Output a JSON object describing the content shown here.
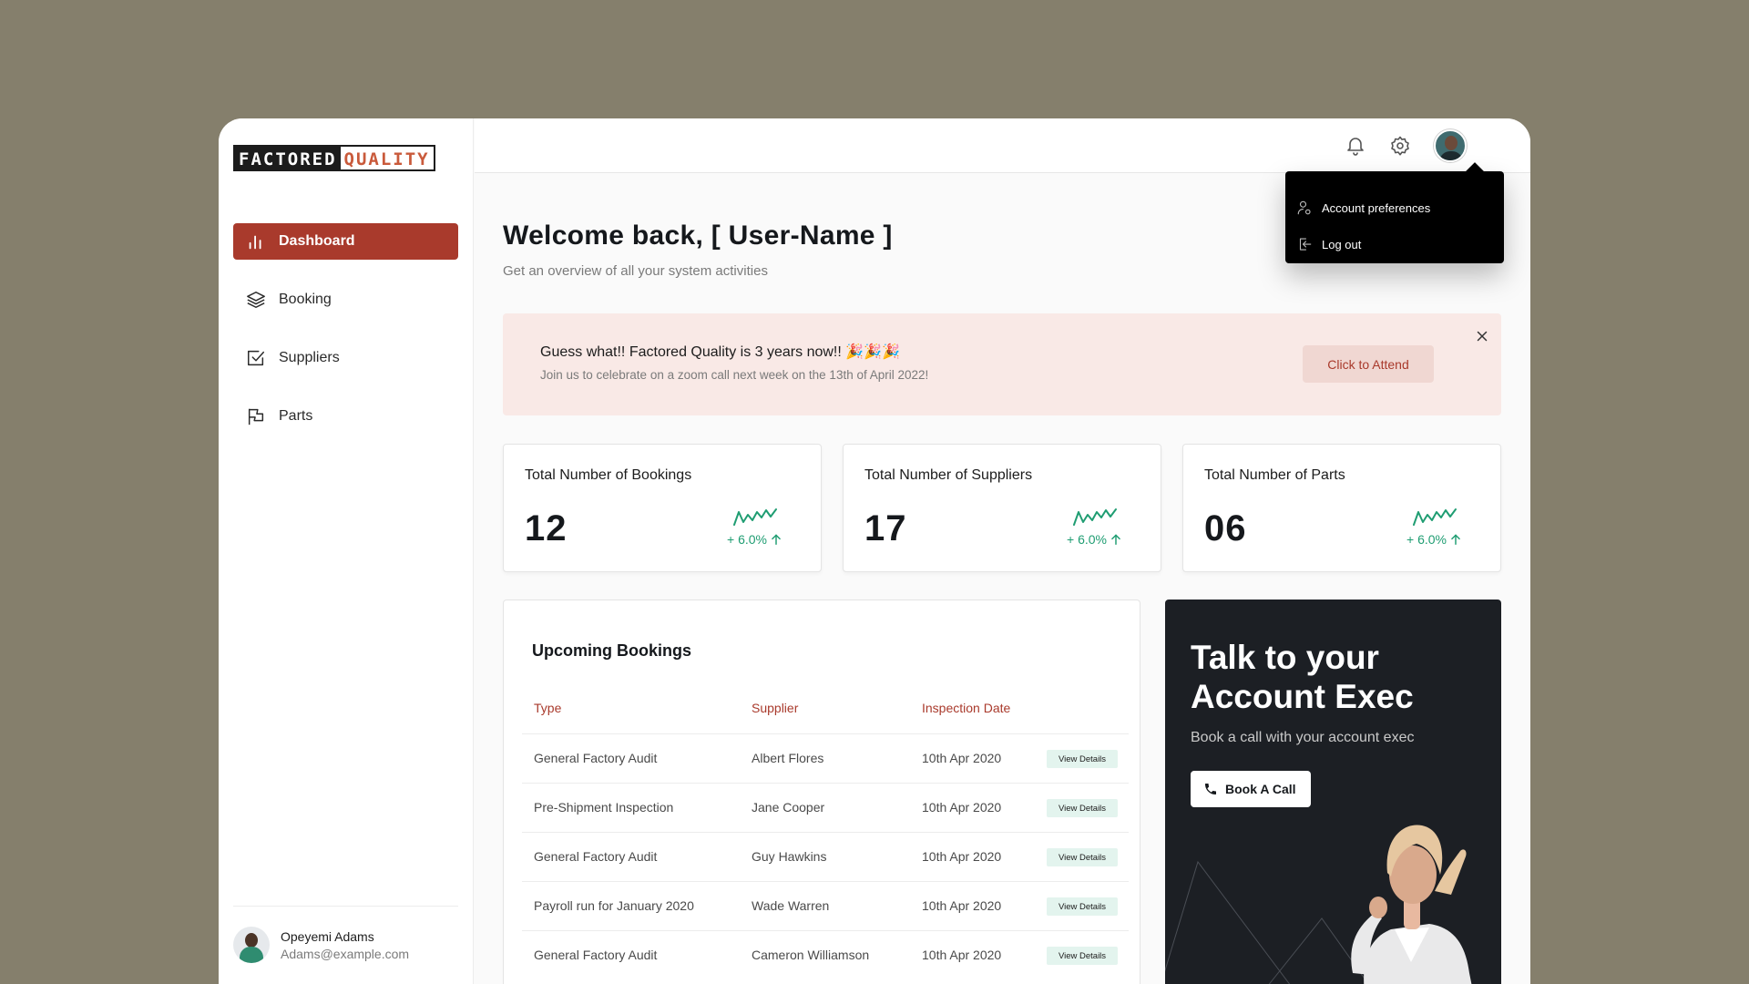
{
  "brand": {
    "logo_left": "FACTORED",
    "logo_right": "QUALITY"
  },
  "sidebar": {
    "items": [
      {
        "label": "Dashboard",
        "icon": "bar-chart-icon",
        "active": true
      },
      {
        "label": "Booking",
        "icon": "layers-icon",
        "active": false
      },
      {
        "label": "Suppliers",
        "icon": "check-square-icon",
        "active": false
      },
      {
        "label": "Parts",
        "icon": "flag-icon",
        "active": false
      }
    ],
    "user": {
      "name": "Opeyemi Adams",
      "email": "Adams@example.com"
    }
  },
  "topbar": {
    "icons": [
      "bell-icon",
      "gear-icon",
      "avatar"
    ],
    "menu": [
      {
        "label": "Account preferences",
        "icon": "user-settings-icon"
      },
      {
        "label": "Log out",
        "icon": "logout-icon"
      }
    ]
  },
  "header": {
    "title": "Welcome back, [ User-Name ]",
    "subtitle": "Get an overview of all your system activities"
  },
  "banner": {
    "title": "Guess what!! Factored Quality is 3 years now!! 🎉🎉🎉",
    "subtitle": "Join us to celebrate on a zoom call next week on the 13th of April 2022!",
    "button": "Click to Attend"
  },
  "stats": [
    {
      "label": "Total Number of Bookings",
      "value": "12",
      "trend": "+ 6.0%"
    },
    {
      "label": "Total Number of Suppliers",
      "value": "17",
      "trend": "+ 6.0%"
    },
    {
      "label": "Total Number of Parts",
      "value": "06",
      "trend": "+ 6.0%"
    }
  ],
  "bookings": {
    "title": "Upcoming Bookings",
    "columns": [
      "Type",
      "Supplier",
      "Inspection Date"
    ],
    "action_label": "View Details",
    "rows": [
      {
        "type": "General Factory Audit",
        "supplier": "Albert Flores",
        "date": "10th Apr 2020"
      },
      {
        "type": "Pre-Shipment Inspection",
        "supplier": "Jane Cooper",
        "date": "10th Apr 2020"
      },
      {
        "type": "General Factory Audit",
        "supplier": "Guy Hawkins",
        "date": "10th Apr 2020"
      },
      {
        "type": "Payroll run for January 2020",
        "supplier": "Wade Warren",
        "date": "10th Apr 2020"
      },
      {
        "type": "General Factory Audit",
        "supplier": "Cameron Williamson",
        "date": "10th Apr 2020"
      }
    ]
  },
  "exec": {
    "title": "Talk to your Account Exec",
    "subtitle": "Book a call with your account exec",
    "button": "Book A Call"
  },
  "colors": {
    "accent": "#a93a2c",
    "positive": "#1f9d72",
    "dark_card": "#1c1f24",
    "banner_bg": "#f9e9e6"
  }
}
